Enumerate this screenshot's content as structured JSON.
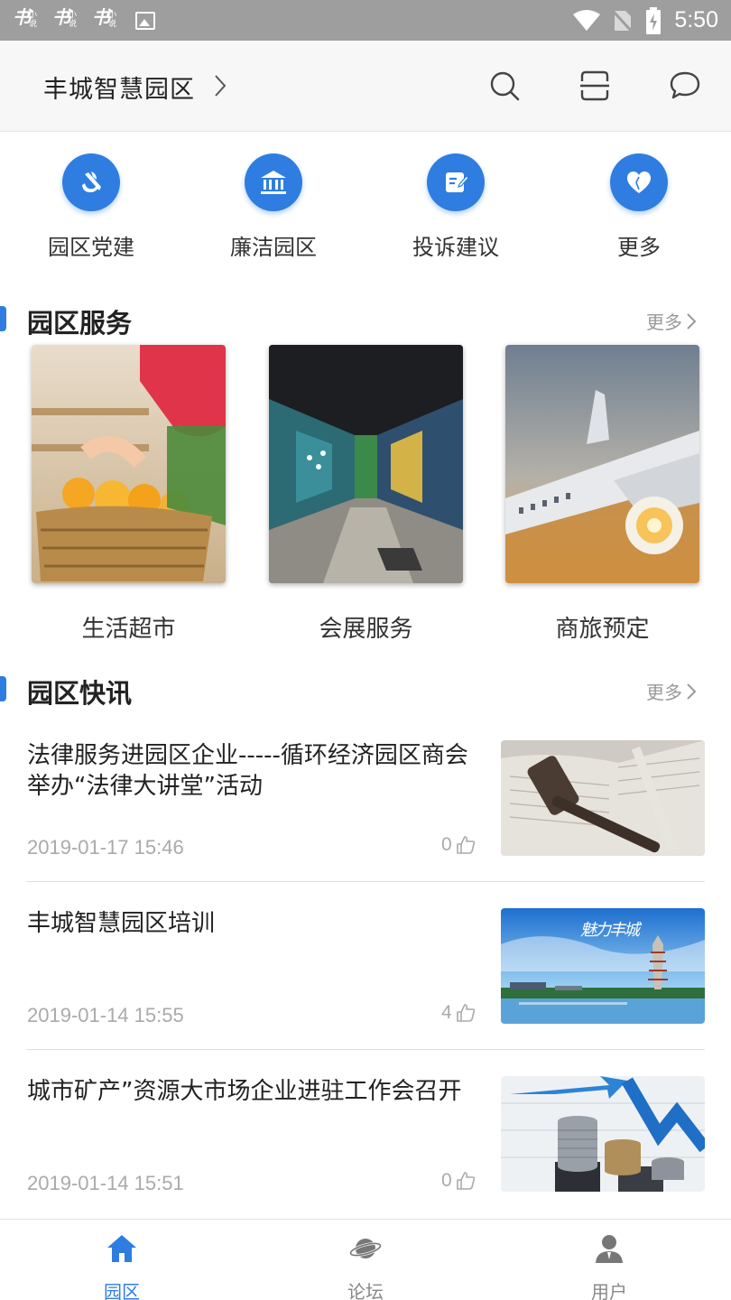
{
  "status_bar": {
    "time": "5:50",
    "notifications": [
      {
        "big": "书",
        "small": "小说"
      },
      {
        "big": "书",
        "small": "小说"
      },
      {
        "big": "书",
        "small": "小说"
      }
    ],
    "icons": [
      "wifi-icon",
      "no-sim-icon",
      "battery-charging-icon"
    ]
  },
  "header": {
    "title": "丰城智慧园区",
    "icons": [
      "search-icon",
      "scan-icon",
      "message-icon"
    ]
  },
  "quick_entries": [
    {
      "label": "园区党建",
      "icon": "party-emblem-icon"
    },
    {
      "label": "廉洁园区",
      "icon": "government-building-icon"
    },
    {
      "label": "投诉建议",
      "icon": "note-edit-icon"
    },
    {
      "label": "更多",
      "icon": "heart-icon"
    }
  ],
  "services": {
    "title": "园区服务",
    "more": "更多",
    "cards": [
      {
        "label": "生活超市",
        "image": "grocery-basket-photo"
      },
      {
        "label": "会展服务",
        "image": "exhibition-hall-photo"
      },
      {
        "label": "商旅预定",
        "image": "airplane-photo"
      }
    ]
  },
  "news": {
    "title": "园区快讯",
    "more": "更多",
    "items": [
      {
        "title": "法律服务进园区企业-----循环经济园区商会举办“法律大讲堂”活动",
        "date": "2019-01-17 15:46",
        "likes": "0",
        "image": "gavel-photo"
      },
      {
        "title": "丰城智慧园区培训",
        "date": "2019-01-14 15:55",
        "likes": "4",
        "image": "city-skyline-photo",
        "image_text": "魅力丰城"
      },
      {
        "title": "城市矿产”资源大市场企业进驻工作会召开",
        "date": "2019-01-14 15:51",
        "likes": "0",
        "image": "coins-chart-photo"
      }
    ]
  },
  "bottom_nav": {
    "active_color": "#2f7de1",
    "items": [
      {
        "label": "园区",
        "icon": "home-icon",
        "active": true
      },
      {
        "label": "论坛",
        "icon": "planet-icon",
        "active": false
      },
      {
        "label": "用户",
        "icon": "user-icon",
        "active": false
      }
    ]
  }
}
